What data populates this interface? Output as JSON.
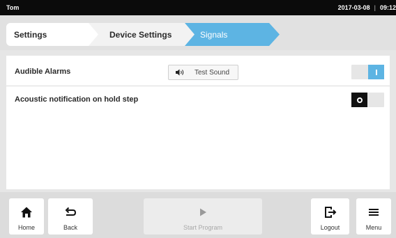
{
  "status_bar": {
    "user": "Tom",
    "date": "2017-03-08",
    "time": "09:12"
  },
  "breadcrumb": {
    "items": [
      {
        "label": "Settings"
      },
      {
        "label": "Device Settings"
      },
      {
        "label": "Signals",
        "active": true
      }
    ]
  },
  "settings": {
    "audible_alarms": {
      "label": "Audible Alarms",
      "test_button": "Test Sound",
      "test_icon": "speaker-icon",
      "toggle_state": "on"
    },
    "acoustic_notification": {
      "label": "Acoustic notification on hold step",
      "toggle_state": "off"
    }
  },
  "nav": {
    "home": {
      "label": "Home",
      "icon": "home-icon"
    },
    "back": {
      "label": "Back",
      "icon": "back-arrow-icon"
    },
    "start_program": {
      "label": "Start Program",
      "icon": "play-icon",
      "enabled": false
    },
    "logout": {
      "label": "Logout",
      "icon": "logout-icon"
    },
    "menu": {
      "label": "Menu",
      "icon": "menu-icon"
    }
  },
  "colors": {
    "accent": "#5db4e3",
    "status_bar": "#0b0b0b",
    "background": "#e6e6e6"
  }
}
